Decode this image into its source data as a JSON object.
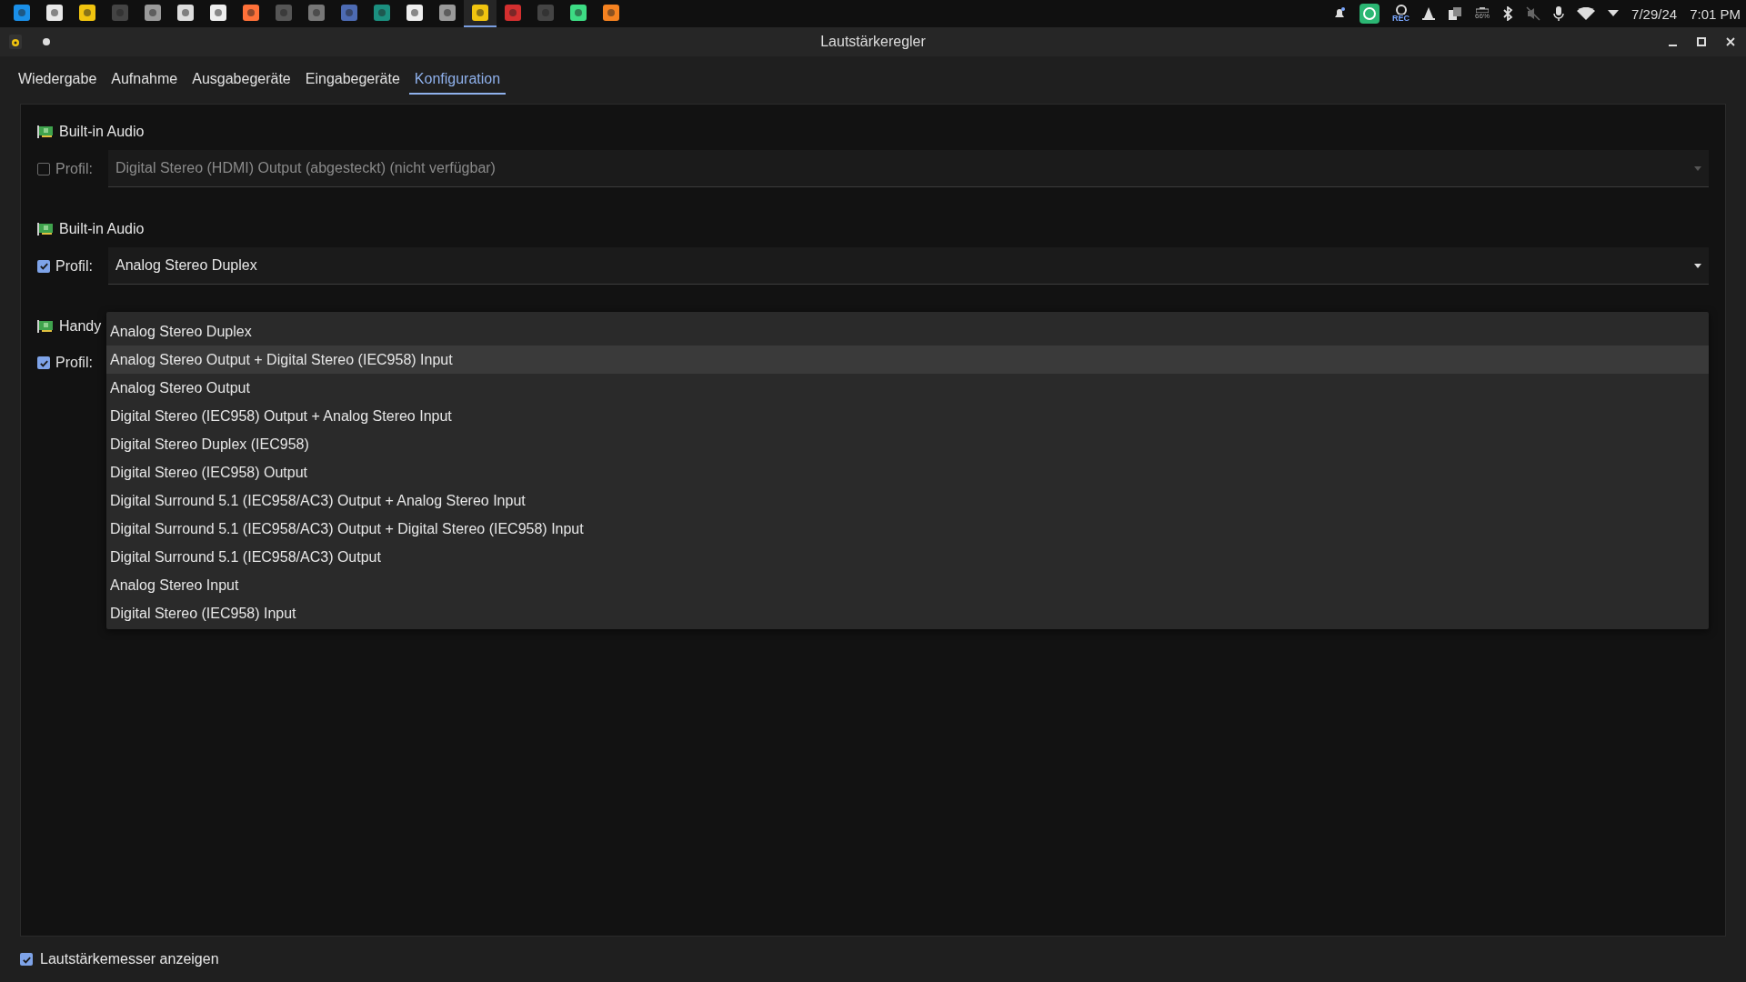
{
  "taskbar": {
    "apps": [
      {
        "selected": false
      },
      {
        "selected": false
      },
      {
        "selected": false
      },
      {
        "selected": false
      },
      {
        "selected": false
      },
      {
        "selected": false
      },
      {
        "selected": false
      },
      {
        "selected": false
      },
      {
        "selected": false
      },
      {
        "selected": false
      },
      {
        "selected": false
      },
      {
        "selected": false
      },
      {
        "selected": false
      },
      {
        "selected": false
      },
      {
        "selected": true
      },
      {
        "selected": false
      },
      {
        "selected": false
      },
      {
        "selected": false
      },
      {
        "selected": false
      }
    ],
    "tray": {
      "rec_label": "REC",
      "battery": "66%",
      "date": "7/29/24",
      "time": "7:01 PM"
    }
  },
  "window": {
    "title": "Lautstärkeregler"
  },
  "tabs": [
    {
      "label": "Wiedergabe",
      "selected": false
    },
    {
      "label": "Aufnahme",
      "selected": false
    },
    {
      "label": "Ausgabegeräte",
      "selected": false
    },
    {
      "label": "Eingabegeräte",
      "selected": false
    },
    {
      "label": "Konfiguration",
      "selected": true
    }
  ],
  "cards": [
    {
      "name": "Built-in Audio",
      "profile_label": "Profil:",
      "checked": false,
      "disabled": true,
      "profile": "Digital Stereo (HDMI) Output (abgesteckt) (nicht verfügbar)"
    },
    {
      "name": "Built-in Audio",
      "profile_label": "Profil:",
      "checked": true,
      "disabled": false,
      "profile": "Analog Stereo Duplex"
    },
    {
      "name": "Handy",
      "profile_label": "Profil:",
      "checked": true,
      "disabled": false
    }
  ],
  "dropdown": {
    "options": [
      {
        "label": "Analog Stereo Duplex",
        "highlighted": false
      },
      {
        "label": "Analog Stereo Output + Digital Stereo (IEC958) Input",
        "highlighted": true
      },
      {
        "label": "Analog Stereo Output",
        "highlighted": false
      },
      {
        "label": "Digital Stereo (IEC958) Output + Analog Stereo Input",
        "highlighted": false
      },
      {
        "label": "Digital Stereo Duplex (IEC958)",
        "highlighted": false
      },
      {
        "label": "Digital Stereo (IEC958) Output",
        "highlighted": false
      },
      {
        "label": "Digital Surround 5.1 (IEC958/AC3) Output + Analog Stereo Input",
        "highlighted": false
      },
      {
        "label": "Digital Surround 5.1 (IEC958/AC3) Output + Digital Stereo (IEC958) Input",
        "highlighted": false
      },
      {
        "label": "Digital Surround 5.1 (IEC958/AC3) Output",
        "highlighted": false
      },
      {
        "label": "Analog Stereo Input",
        "highlighted": false
      },
      {
        "label": "Digital Stereo (IEC958) Input",
        "highlighted": false
      }
    ]
  },
  "footer": {
    "label": "Lautstärkemesser anzeigen",
    "checked": true
  }
}
